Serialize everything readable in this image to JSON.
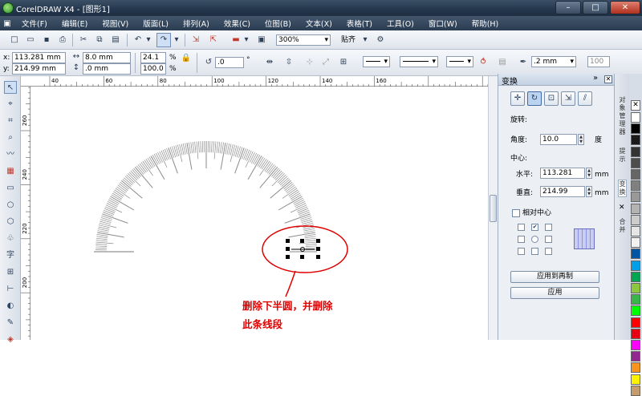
{
  "window": {
    "title": "CorelDRAW X4 - [图形1]",
    "min": "–",
    "max": "□",
    "close": "✕"
  },
  "menu": [
    "文件(F)",
    "编辑(E)",
    "视图(V)",
    "版面(L)",
    "排列(A)",
    "效果(C)",
    "位图(B)",
    "文本(X)",
    "表格(T)",
    "工具(O)",
    "窗口(W)",
    "帮助(H)"
  ],
  "toolbar": {
    "zoom": "300%",
    "snap": "贴齐"
  },
  "property_bar": {
    "x_label": "x:",
    "x_value": "113.281 mm",
    "y_label": "y:",
    "y_value": "214.99 mm",
    "w_value": "8.0 mm",
    "h_value": ".0 mm",
    "scale_x": "24.1",
    "scale_y": "100.0",
    "percent": "%",
    "angle": ".0",
    "degree": "°",
    "outline_width": ".2 mm",
    "outline_value": "100"
  },
  "ruler": {
    "h_ticks": [
      "40",
      "60",
      "80",
      "100",
      "120",
      "140",
      "160"
    ],
    "v_ticks": [
      "260",
      "240",
      "220",
      "200"
    ]
  },
  "docker": {
    "title": "变换",
    "section": "旋转:",
    "angle_label": "角度:",
    "angle_value": "10.0",
    "angle_unit": "度",
    "center_label": "中心:",
    "h_label": "水平:",
    "h_value": "113.281",
    "h_unit": "mm",
    "v_label": "垂直:",
    "v_value": "214.99",
    "v_unit": "mm",
    "relative_label": "相对中心",
    "apply_copy": "应用到再制",
    "apply": "应用"
  },
  "side_tabs": [
    "对象管理器",
    "提示",
    "变换",
    "合并"
  ],
  "palette": [
    "#ffffff",
    "#000000",
    "#1a1a1a",
    "#333333",
    "#4d4d4d",
    "#666666",
    "#808080",
    "#999999",
    "#b3b3b3",
    "#cccccc",
    "#e6e6e6",
    "#f2f2f2",
    "#0055a5",
    "#00a0e9",
    "#00a651",
    "#8dc63f",
    "#39b54a",
    "#00ff00",
    "#ff0000",
    "#e60012",
    "#ff00ff",
    "#92278f",
    "#f7941d",
    "#fff200",
    "#c69c6d"
  ],
  "annotation": {
    "line1": "删除下半圆，并删除",
    "line2": "此条线段"
  },
  "annotation_color": "#e00000"
}
